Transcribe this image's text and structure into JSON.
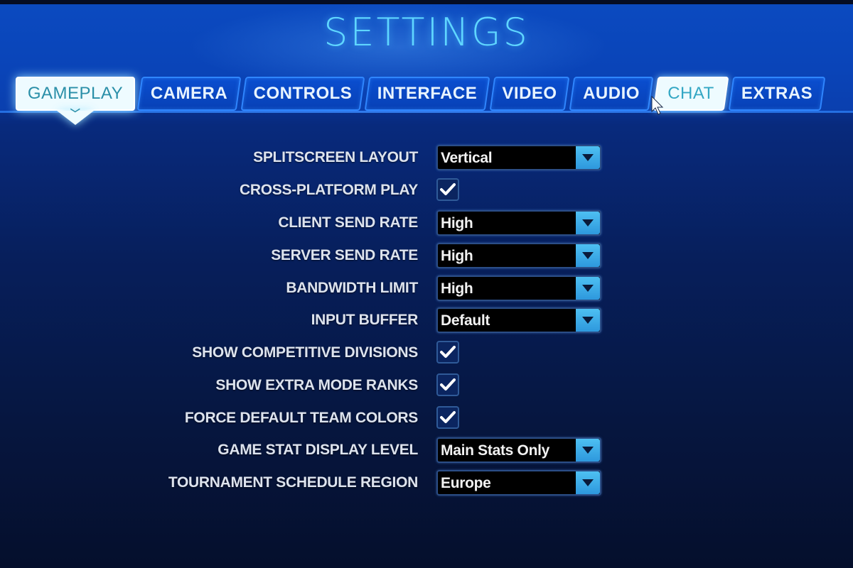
{
  "page": {
    "title": "SETTINGS"
  },
  "tabs": [
    {
      "label": "GAMEPLAY",
      "state": "active"
    },
    {
      "label": "CAMERA",
      "state": "normal"
    },
    {
      "label": "CONTROLS",
      "state": "normal"
    },
    {
      "label": "INTERFACE",
      "state": "normal"
    },
    {
      "label": "VIDEO",
      "state": "normal"
    },
    {
      "label": "AUDIO",
      "state": "normal"
    },
    {
      "label": "CHAT",
      "state": "hover"
    },
    {
      "label": "EXTRAS",
      "state": "normal"
    }
  ],
  "settings": [
    {
      "label": "SPLITSCREEN LAYOUT",
      "type": "dropdown",
      "value": "Vertical"
    },
    {
      "label": "CROSS-PLATFORM PLAY",
      "type": "checkbox",
      "checked": true
    },
    {
      "label": "CLIENT SEND RATE",
      "type": "dropdown",
      "value": "High"
    },
    {
      "label": "SERVER SEND RATE",
      "type": "dropdown",
      "value": "High"
    },
    {
      "label": "BANDWIDTH LIMIT",
      "type": "dropdown",
      "value": "High"
    },
    {
      "label": "INPUT BUFFER",
      "type": "dropdown",
      "value": "Default"
    },
    {
      "label": "SHOW COMPETITIVE DIVISIONS",
      "type": "checkbox",
      "checked": true
    },
    {
      "label": "SHOW EXTRA MODE RANKS",
      "type": "checkbox",
      "checked": true
    },
    {
      "label": "FORCE DEFAULT TEAM COLORS",
      "type": "checkbox",
      "checked": true
    },
    {
      "label": "GAME STAT DISPLAY LEVEL",
      "type": "dropdown",
      "value": "Main Stats Only"
    },
    {
      "label": "TOURNAMENT SCHEDULE REGION",
      "type": "dropdown",
      "value": "Europe"
    }
  ],
  "colors": {
    "title": "#5fd6ff",
    "tab_border": "#2f86ff",
    "active_tab_bg": "#eefbff",
    "dropdown_arrow": "#3fb0ea"
  }
}
